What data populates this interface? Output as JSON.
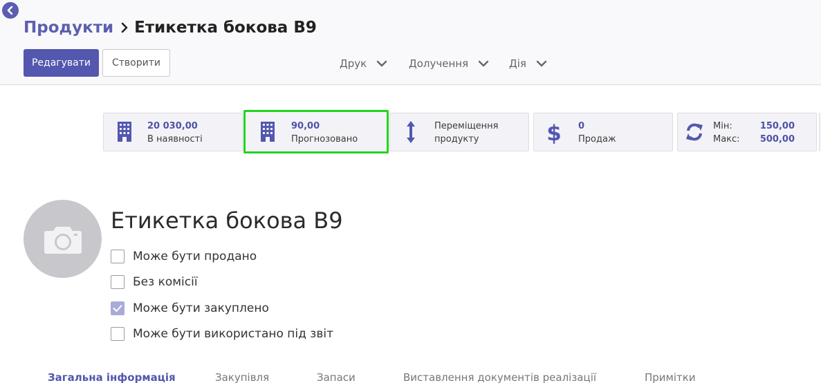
{
  "breadcrumb": {
    "parent": "Продукти",
    "current": "Етикетка бокова B9"
  },
  "toolbar": {
    "edit_label": "Редагувати",
    "create_label": "Створити"
  },
  "dropdowns": {
    "print": "Друк",
    "attach": "Долучення",
    "action": "Дія"
  },
  "stat_buttons": {
    "on_hand": {
      "value": "20 030,00",
      "label": "В наявності",
      "icon": "building-icon"
    },
    "forecast": {
      "value": "90,00",
      "label": "Прогнозовано",
      "icon": "building-icon"
    },
    "moves": {
      "line1": "Переміщення",
      "line2": "продукту",
      "icon": "vertical-arrows-icon"
    },
    "sales": {
      "value": "0",
      "label": "Продаж",
      "icon": "dollar-icon"
    },
    "reorder": {
      "min_label": "Мін:",
      "min_value": "150,00",
      "max_label": "Макс:",
      "max_value": "500,00",
      "icon": "refresh-icon"
    }
  },
  "product": {
    "title": "Етикетка бокова B9",
    "options": [
      {
        "label": "Може бути продано",
        "checked": false
      },
      {
        "label": "Без комісії",
        "checked": false
      },
      {
        "label": "Може бути закуплено",
        "checked": true
      },
      {
        "label": "Може бути використано під звіт",
        "checked": false
      }
    ]
  },
  "tabs": [
    {
      "label": "Загальна інформація",
      "active": true
    },
    {
      "label": "Закупівля",
      "active": false
    },
    {
      "label": "Запаси",
      "active": false
    },
    {
      "label": "Виставлення документів реалізації",
      "active": false
    },
    {
      "label": "Примітки",
      "active": false
    }
  ],
  "colors": {
    "accent": "#5357ae",
    "highlight": "#22d41f"
  }
}
